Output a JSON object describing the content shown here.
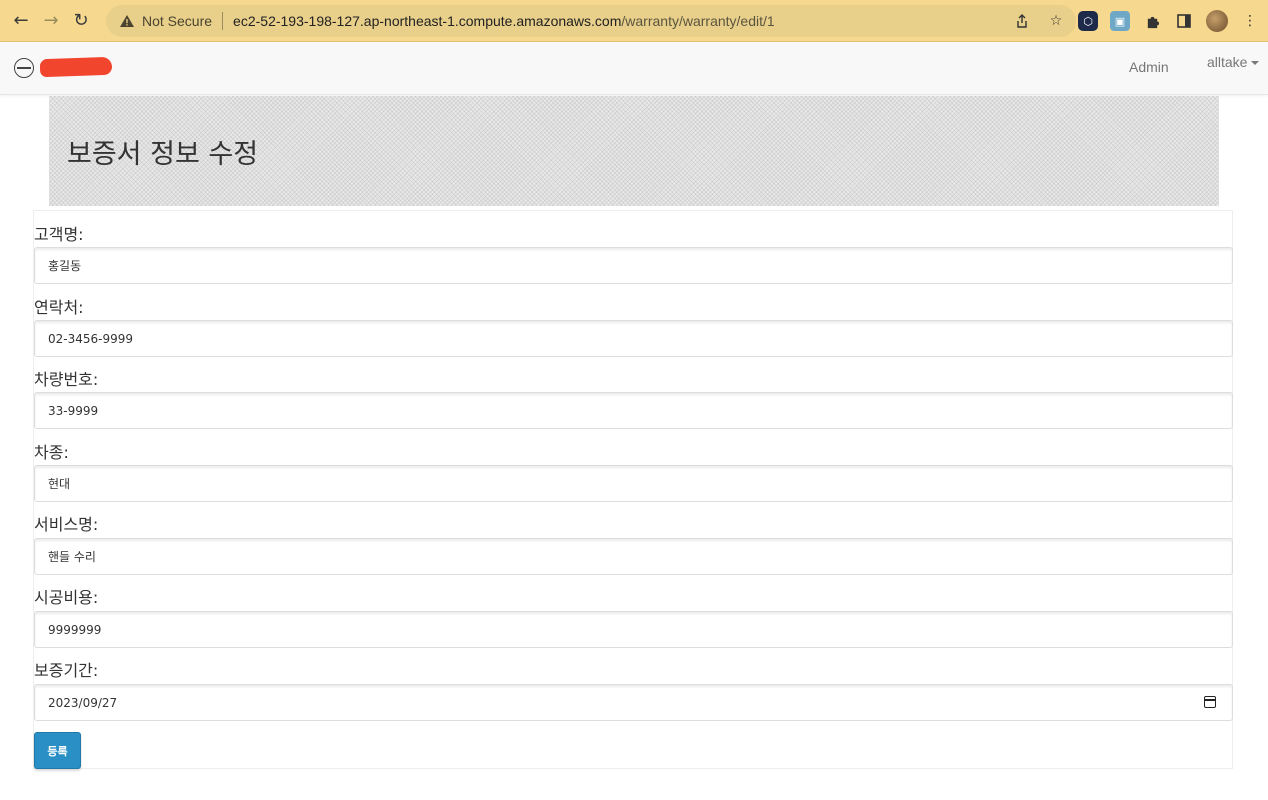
{
  "browser": {
    "security_label": "Not Secure",
    "url_host": "ec2-52-193-198-127.ap-northeast-1.compute.amazonaws.com",
    "url_path": "/warranty/warranty/edit/1",
    "back_icon": "arrow-left-icon",
    "forward_icon": "arrow-right-icon",
    "reload_icon": "reload-icon"
  },
  "navbar": {
    "admin_label": "Admin",
    "user_label": "alltake"
  },
  "page": {
    "title": "보증서 정보 수정"
  },
  "form": {
    "fields": [
      {
        "label": "고객명:",
        "value": "홍길동"
      },
      {
        "label": "연락처:",
        "value": "02-3456-9999"
      },
      {
        "label": "차량번호:",
        "value": "33-9999"
      },
      {
        "label": "차종:",
        "value": "현대"
      },
      {
        "label": "서비스명:",
        "value": "핸들 수리"
      },
      {
        "label": "시공비용:",
        "value": "9999999"
      },
      {
        "label": "보증기간:",
        "value": "2023/09/27"
      }
    ],
    "submit_label": "등록"
  },
  "colors": {
    "chrome_bg": "#f6d98e",
    "submit_bg": "#2a8fc5",
    "redaction": "#f2452e"
  }
}
